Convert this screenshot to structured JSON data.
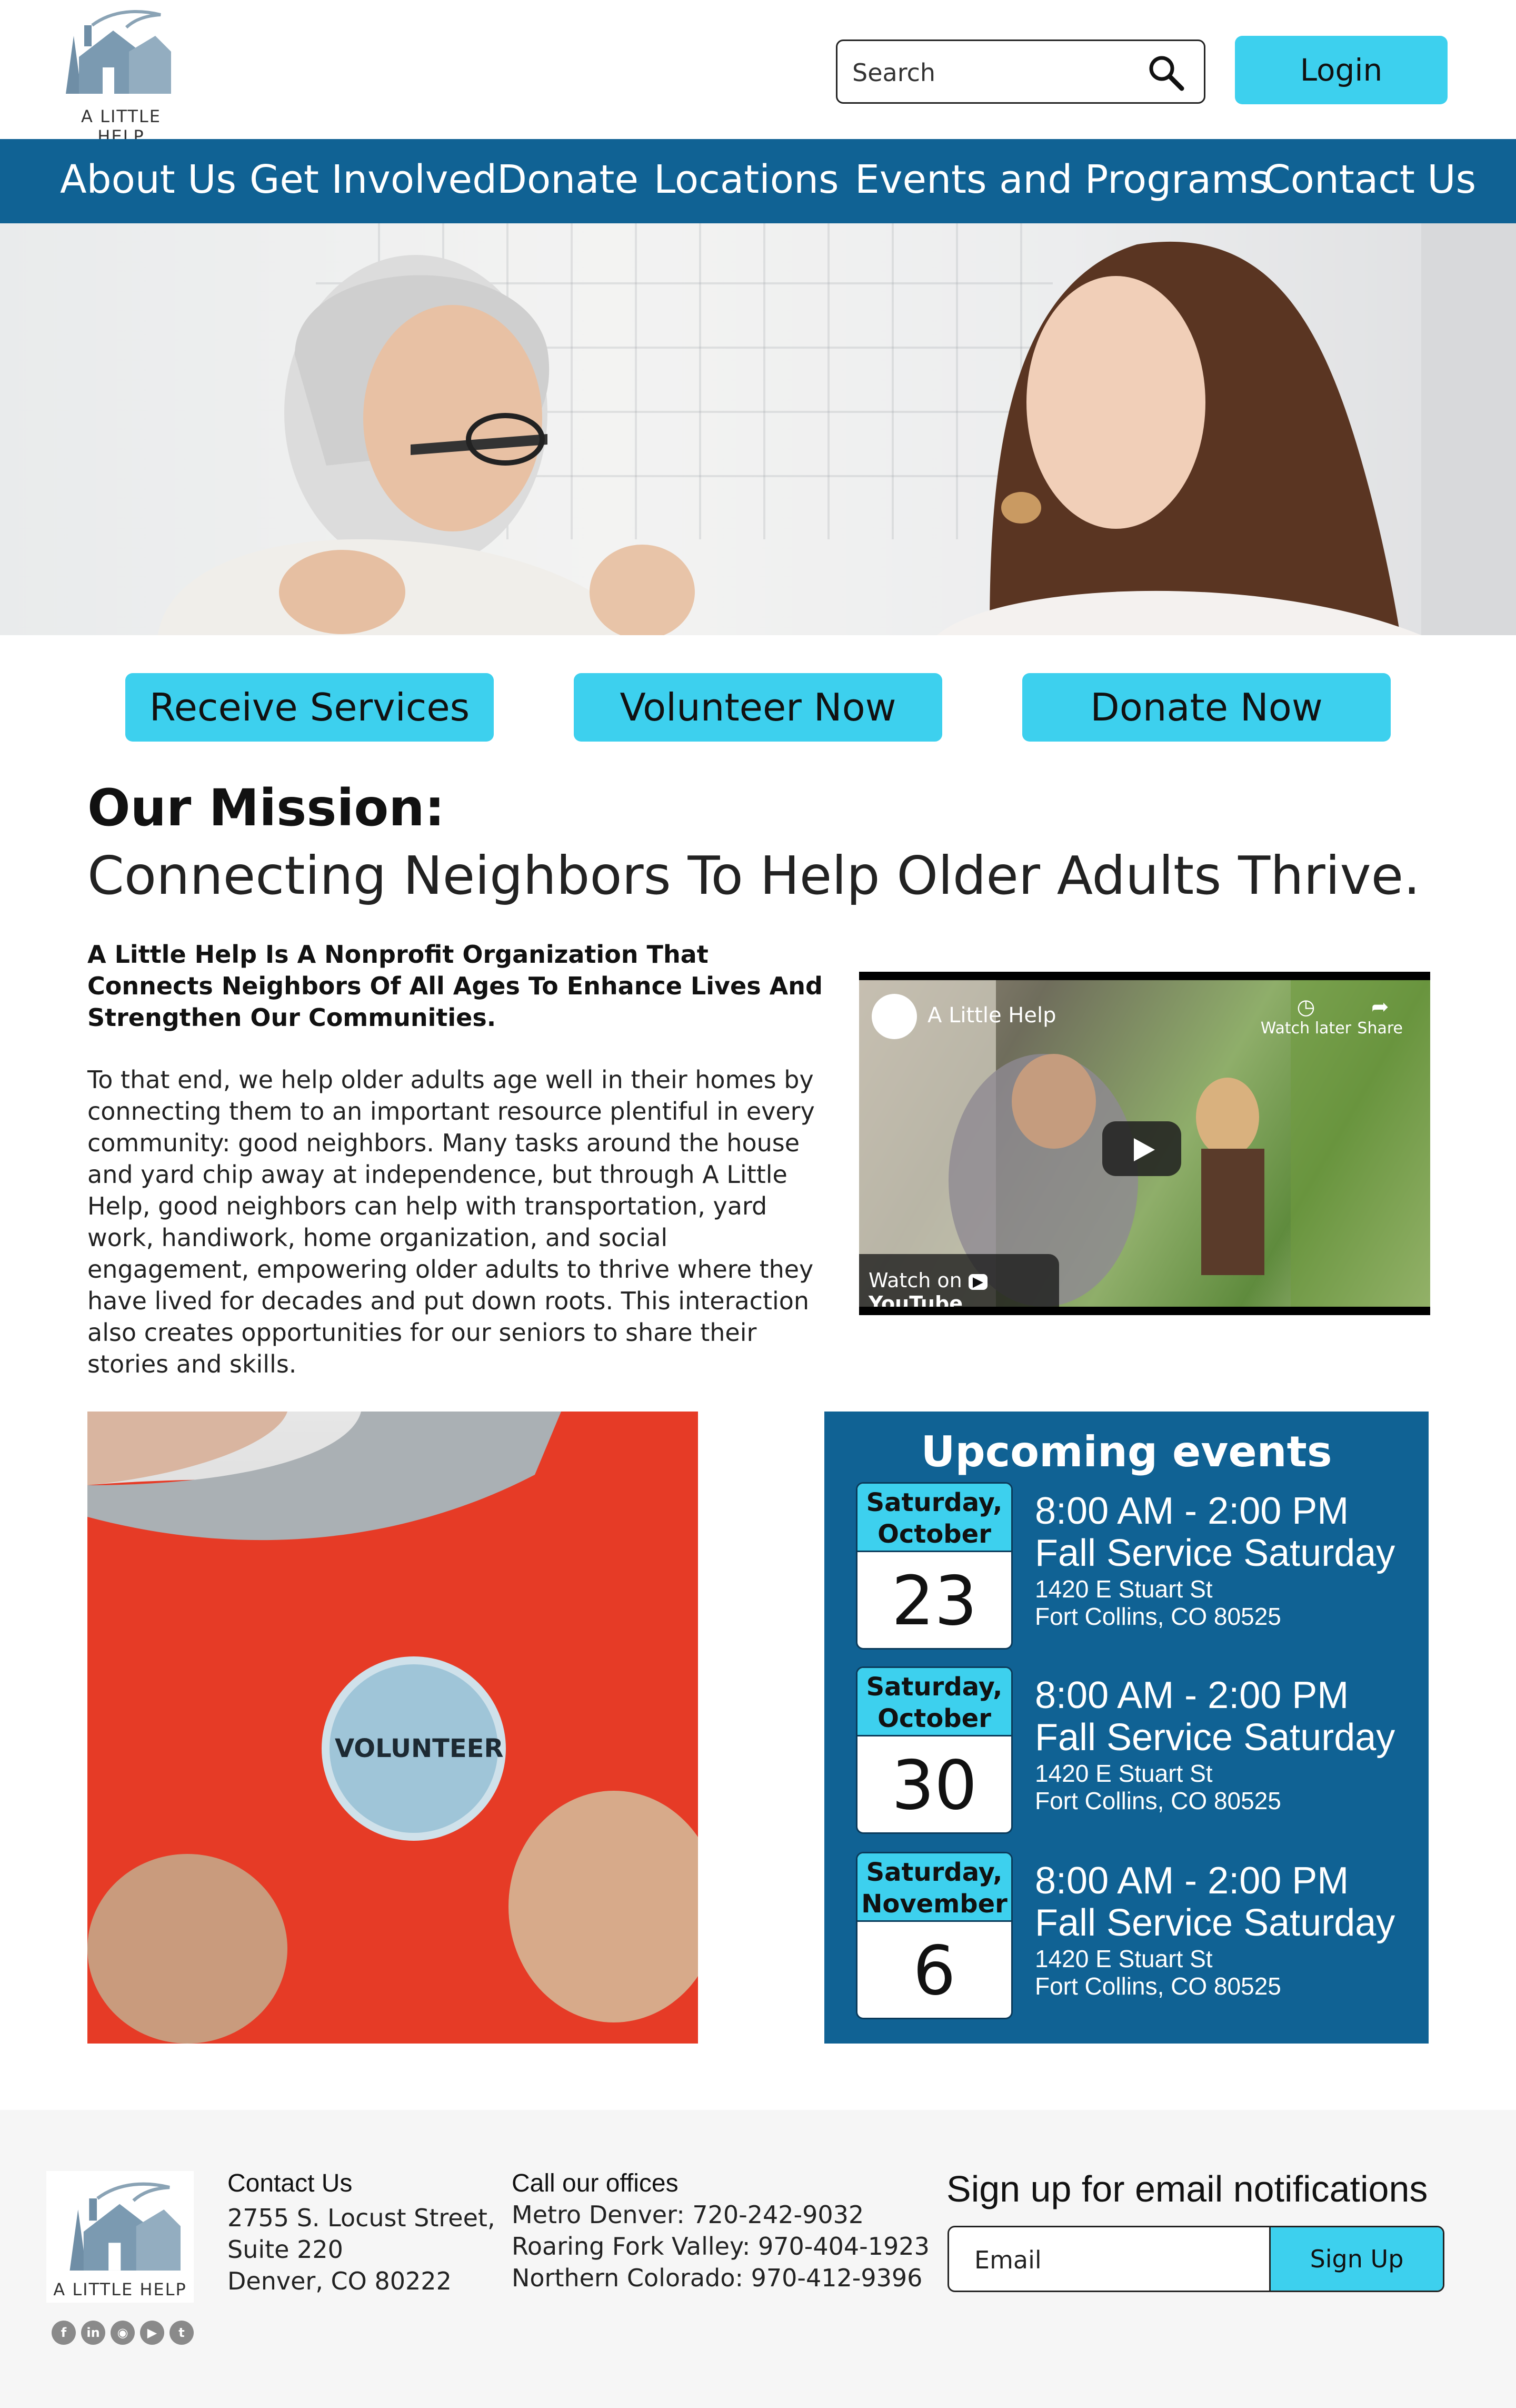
{
  "header": {
    "logo_text": "A LITTLE HELP",
    "search_placeholder": "Search",
    "login_label": "Login"
  },
  "nav": {
    "items": [
      "About Us",
      "Get Involved",
      "Donate",
      "Locations",
      "Events and Programs",
      "Contact Us"
    ]
  },
  "cta": {
    "receive": "Receive Services",
    "volunteer": "Volunteer Now",
    "donate": "Donate Now"
  },
  "mission": {
    "title": "Our Mission:",
    "subtitle": "Connecting Neighbors To Help Older Adults Thrive.",
    "lead": "A Little Help Is A Nonprofit Organization That Connects Neighbors Of All Ages To Enhance Lives And Strengthen Our Communities.",
    "body": "To that end, we help older adults age well in their homes by connecting them to an important resource plentiful in every community: good neighbors. Many tasks around the house and yard chip away at independence, but through A Little Help, good neighbors can help with transportation, yard work, handiwork, home organization, and social engagement, empowering older adults to thrive where they have lived for decades and put down roots. This interaction also creates opportunities for our seniors to share their stories and skills."
  },
  "video": {
    "title": "A Little Help",
    "watch_later": "Watch later",
    "share": "Share",
    "watch_on": "Watch on",
    "youtube": "YouTube"
  },
  "volunteer_image": {
    "badge_text": "VOLUNTEER"
  },
  "events": {
    "title": "Upcoming events",
    "items": [
      {
        "weekday": "Saturday,",
        "month": "October",
        "day": "23",
        "time": "8:00 AM - 2:00 PM",
        "name": "Fall Service Saturday",
        "street": "1420 E Stuart St",
        "city": "Fort Collins, CO 80525"
      },
      {
        "weekday": "Saturday,",
        "month": "October",
        "day": "30",
        "time": "8:00 AM - 2:00 PM",
        "name": "Fall Service Saturday",
        "street": "1420 E Stuart St",
        "city": "Fort Collins, CO 80525"
      },
      {
        "weekday": "Saturday,",
        "month": "November",
        "day": "6",
        "time": "8:00 AM - 2:00 PM",
        "name": "Fall Service Saturday",
        "street": "1420 E Stuart St",
        "city": "Fort Collins, CO 80525"
      }
    ]
  },
  "footer": {
    "logo_text": "A LITTLE HELP",
    "contact_title": "Contact Us",
    "address": [
      "2755 S. Locust Street,",
      "Suite 220",
      "Denver, CO 80222"
    ],
    "call_title": "Call our offices",
    "phones": [
      "Metro Denver: 720-242-9032",
      "Roaring Fork Valley: 970-404-1923",
      "Northern Colorado: 970-412-9396"
    ],
    "signup_title": "Sign up for email notifications",
    "email_placeholder": "Email",
    "signup_button": "Sign Up",
    "socials": [
      "facebook-icon",
      "linkedin-icon",
      "instagram-icon",
      "youtube-icon",
      "twitter-icon"
    ]
  },
  "colors": {
    "nav_blue": "#106294",
    "accent_cyan": "#3dd0ee",
    "footer_bg": "#f6f6f6"
  }
}
